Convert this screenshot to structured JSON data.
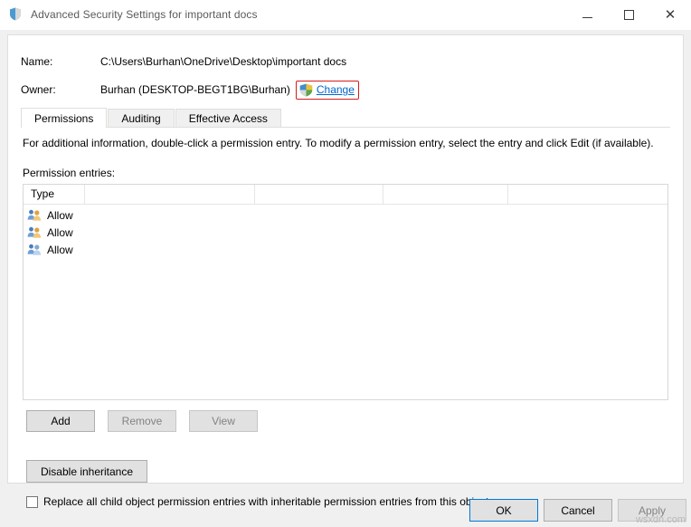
{
  "window": {
    "title": "Advanced Security Settings for important docs",
    "title_icon": "shield-icon",
    "minimize_label": "–",
    "maximize_label": "□",
    "close_label": "✕"
  },
  "fields": {
    "name_label": "Name:",
    "name_value": "C:\\Users\\Burhan\\OneDrive\\Desktop\\important docs",
    "owner_label": "Owner:",
    "owner_value": "Burhan (DESKTOP-BEGT1BG\\Burhan)",
    "change_link": "Change"
  },
  "tabs": [
    {
      "label": "Permissions",
      "active": true
    },
    {
      "label": "Auditing",
      "active": false
    },
    {
      "label": "Effective Access",
      "active": false
    }
  ],
  "main": {
    "info_text": "For additional information, double-click a permission entry. To modify a permission entry, select the entry and click Edit (if available).",
    "entries_label": "Permission entries:"
  },
  "listview": {
    "columns": [
      "Type",
      "",
      "",
      "",
      ""
    ],
    "rows": [
      {
        "icon": "users-icon",
        "type": "Allow"
      },
      {
        "icon": "users-icon",
        "type": "Allow"
      },
      {
        "icon": "users-icon",
        "type": "Allow"
      }
    ]
  },
  "buttons": {
    "add": "Add",
    "remove": "Remove",
    "view": "View",
    "disable_inheritance": "Disable inheritance",
    "ok": "OK",
    "cancel": "Cancel",
    "apply": "Apply"
  },
  "checkbox": {
    "label": "Replace all child object permission entries with inheritable permission entries from this object",
    "checked": false
  },
  "watermark": "wsxdn.com",
  "colors": {
    "link": "#0066cc",
    "highlight_border": "#d91a1a",
    "default_button_border": "#0078d7"
  }
}
